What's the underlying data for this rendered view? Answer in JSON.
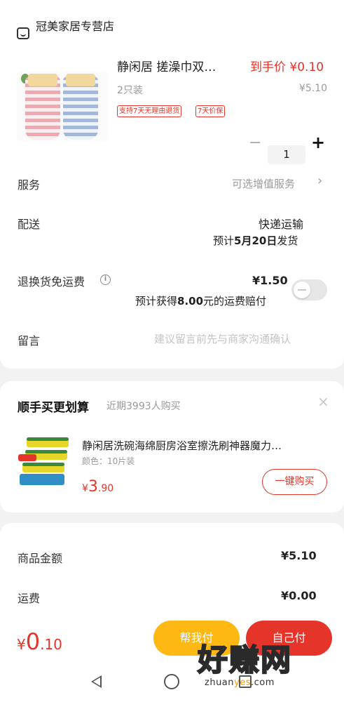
{
  "store": {
    "name": "冠美家居专营店",
    "icon": "store-icon"
  },
  "product": {
    "title": "静闲居 搓澡巾双…",
    "spec": "2只装",
    "final_price_label": "到手价 ¥0.10",
    "original_price": "¥5.10",
    "tags": [
      "支持7天无理由退货",
      "7天价保"
    ],
    "quantity": "1",
    "minus": "−",
    "plus": "+"
  },
  "service": {
    "label": "服务",
    "value": "可选增值服务",
    "chevron": "›"
  },
  "delivery": {
    "label": "配送",
    "method": "快递运输",
    "estimate_prefix": "预计",
    "estimate_date": "5月20日",
    "estimate_suffix": "发货"
  },
  "return_insurance": {
    "label": "退换货免运费",
    "info": "i",
    "price": "¥1.50",
    "note_prefix": "预计获得",
    "note_amount": "8.00",
    "note_suffix": "元的运费赔付",
    "enabled": false
  },
  "message": {
    "label": "留言",
    "placeholder": "建议留言前先与商家沟通确认"
  },
  "recommend": {
    "title": "顺手买更划算",
    "subtitle": "近期3993人购买",
    "close": "×",
    "item_title": "静闲居洗碗海绵厨房浴室擦洗刷神器魔力…",
    "item_spec": "颜色：10片装",
    "price_symbol": "¥",
    "price_int": "3",
    "price_dec": ".90",
    "buy_label": "一键购买"
  },
  "summary": {
    "goods_label": "商品金额",
    "goods_value": "¥5.10",
    "shipping_label": "运费",
    "shipping_value": "¥0.00"
  },
  "bottom": {
    "total_symbol": "¥",
    "total_int": "0",
    "total_dec": ".10",
    "help_pay": "帮我付",
    "self_pay": "自己付"
  },
  "watermark": {
    "big": "好赚网",
    "small_a": "zhuan",
    "small_b": "yes",
    "small_c": ".com"
  },
  "colors": {
    "accent_red": "#e5342a",
    "help_pay_yellow": "#fdb813",
    "watermark_orange": "#f39800"
  }
}
